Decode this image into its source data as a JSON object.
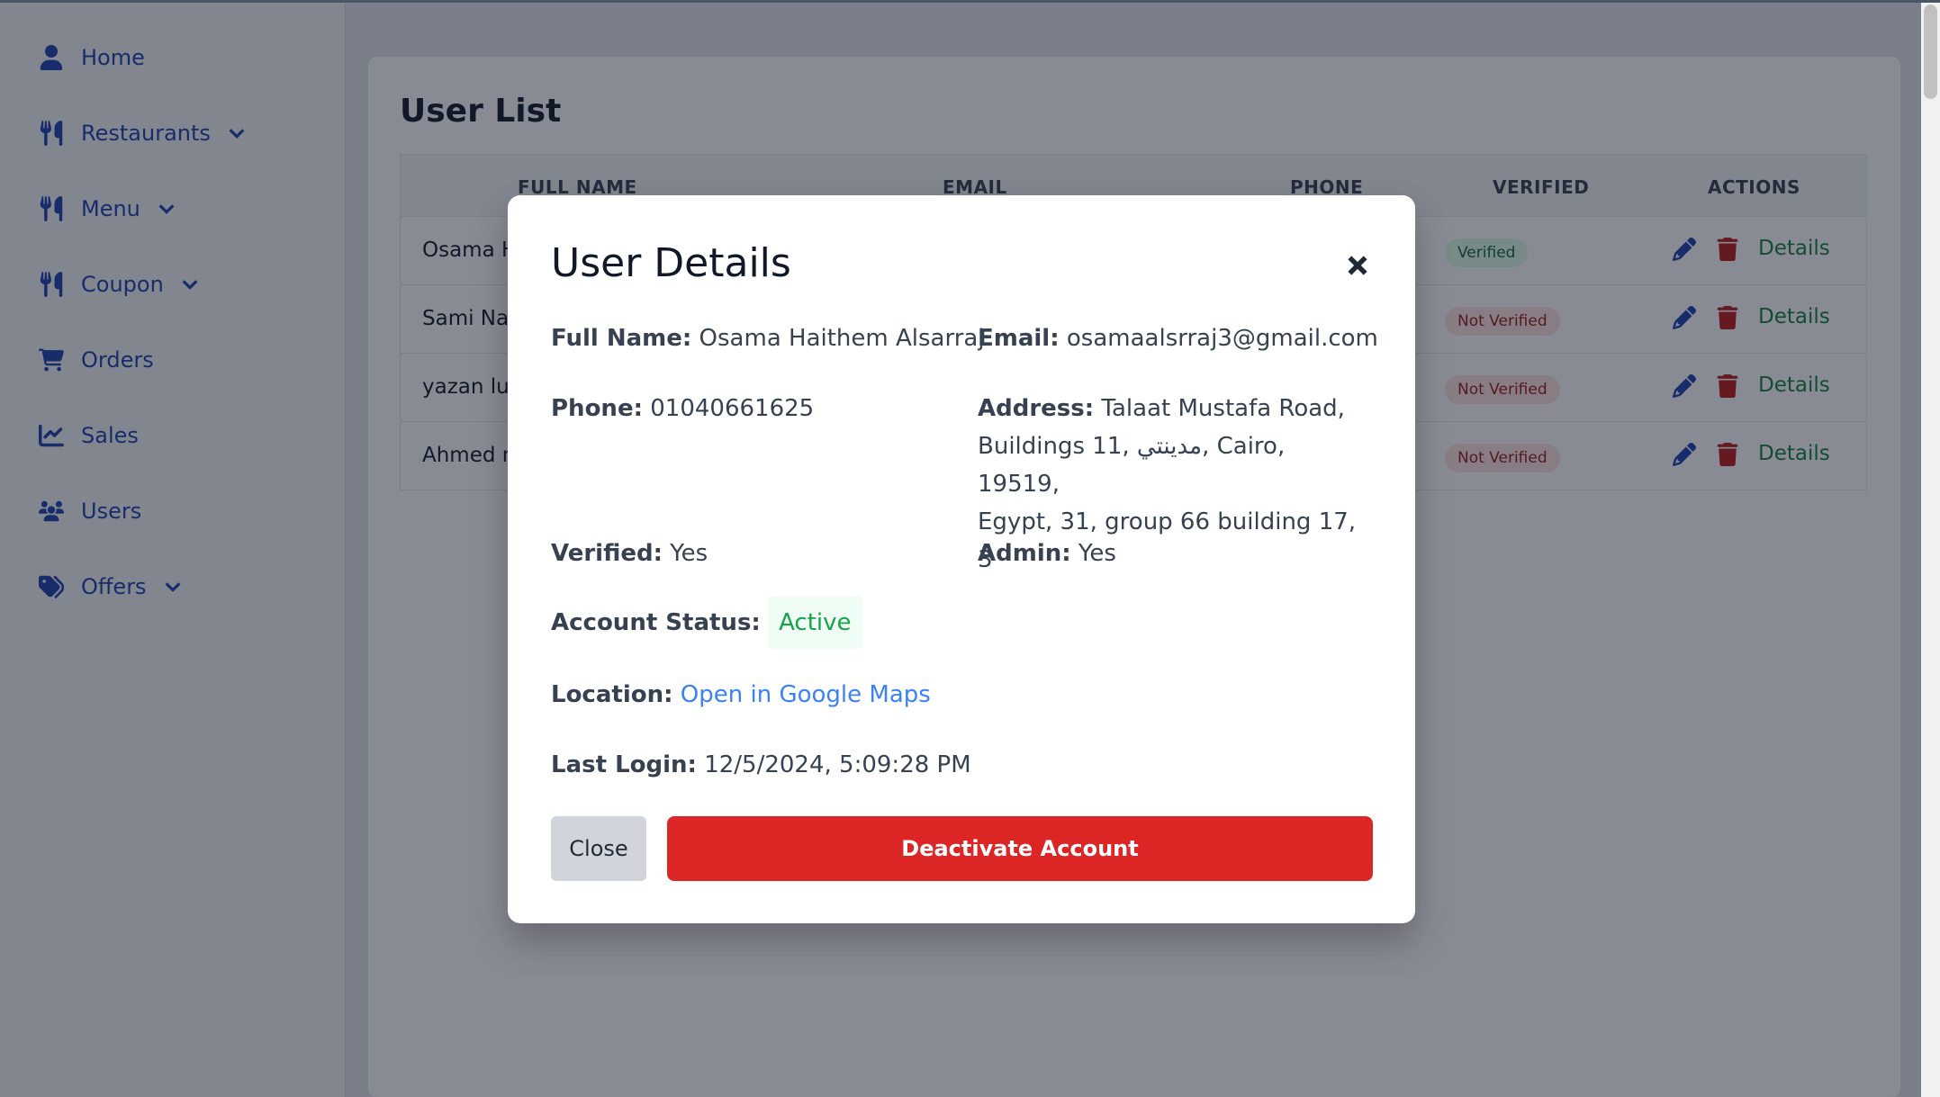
{
  "sidebar": {
    "items": [
      {
        "label": "Home",
        "icon": "user-icon",
        "dropdown": false
      },
      {
        "label": "Restaurants",
        "icon": "utensils-icon",
        "dropdown": true
      },
      {
        "label": "Menu",
        "icon": "utensils-icon",
        "dropdown": true
      },
      {
        "label": "Coupon",
        "icon": "utensils-icon",
        "dropdown": true
      },
      {
        "label": "Orders",
        "icon": "cart-icon",
        "dropdown": false
      },
      {
        "label": "Sales",
        "icon": "chart-line-icon",
        "dropdown": false
      },
      {
        "label": "Users",
        "icon": "users-icon",
        "dropdown": false
      },
      {
        "label": "Offers",
        "icon": "tags-icon",
        "dropdown": true
      }
    ]
  },
  "page": {
    "title": "User List",
    "columns": [
      "FULL NAME",
      "EMAIL",
      "PHONE",
      "VERIFIED",
      "ACTIONS"
    ],
    "rows": [
      {
        "name": "Osama H",
        "verified": "Verified",
        "details": "Details"
      },
      {
        "name": "Sami Nab",
        "verified": "Not Verified",
        "details": "Details"
      },
      {
        "name": "yazan lub",
        "verified": "Not Verified",
        "details": "Details"
      },
      {
        "name": "Ahmed m",
        "verified": "Not Verified",
        "details": "Details"
      }
    ]
  },
  "modal": {
    "title": "User Details",
    "full_name_label": "Full Name:",
    "full_name": "Osama Haithem Alsarraj",
    "email_label": "Email:",
    "email": "osamaalsrraj3@gmail.com",
    "phone_label": "Phone:",
    "phone": "01040661625",
    "address_label": "Address:",
    "address_line1": "Talaat Mustafa Road,",
    "address_line2": "Buildings 11, مدينتي, Cairo, 19519,",
    "address_line3": "Egypt, 31, group 66 building 17, 3",
    "verified_label": "Verified:",
    "verified": "Yes",
    "admin_label": "Admin:",
    "admin": "Yes",
    "status_label": "Account Status:",
    "status": "Active",
    "location_label": "Location:",
    "location_link": "Open in Google Maps",
    "last_login_label": "Last Login:",
    "last_login": "12/5/2024, 5:09:28 PM",
    "close_label": "Close",
    "deactivate_label": "Deactivate Account"
  },
  "colors": {
    "nav": "#1e40af",
    "danger": "#dc2626",
    "success": "#16a34a",
    "link": "#3b82f6"
  }
}
